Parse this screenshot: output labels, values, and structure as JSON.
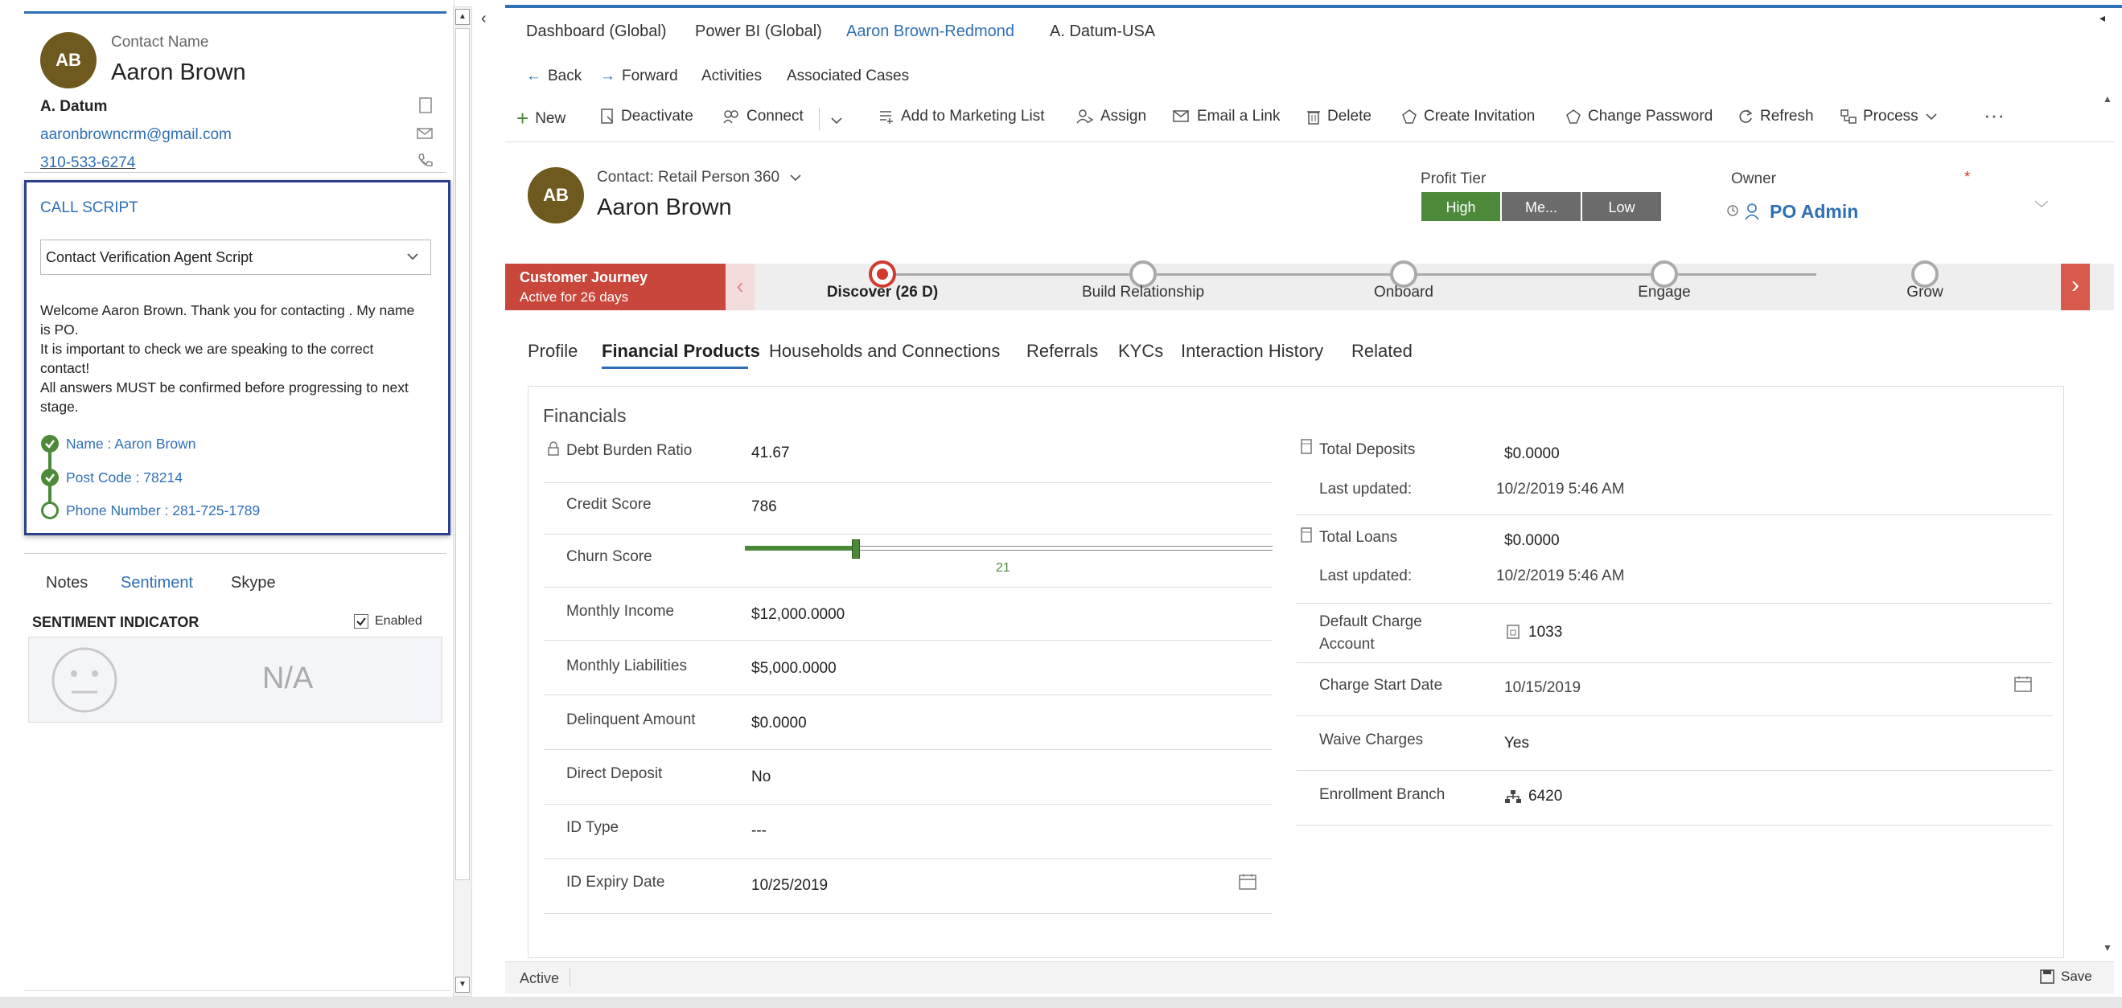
{
  "contact_card": {
    "initials": "AB",
    "label": "Contact Name",
    "name": "Aaron Brown",
    "company": "A. Datum",
    "email": "aaronbrowncrm@gmail.com",
    "phone": "310-533-6274"
  },
  "call_script": {
    "title": "CALL SCRIPT",
    "selected_script": "Contact Verification Agent Script",
    "lines": [
      "Welcome Aaron Brown. Thank you for contacting . My name",
      "is PO.",
      "It is important to check we are speaking to the correct",
      "contact!",
      "All answers MUST be confirmed before progressing to next",
      "stage."
    ],
    "checks": [
      {
        "label": "Name : Aaron Brown",
        "done": true
      },
      {
        "label": "Post Code : 78214",
        "done": true
      },
      {
        "label": "Phone Number : 281-725-1789",
        "done": false
      }
    ]
  },
  "bottom_tabs": {
    "notes": "Notes",
    "sentiment": "Sentiment",
    "skype": "Skype"
  },
  "sentiment": {
    "title": "SENTIMENT INDICATOR",
    "enabled_label": "Enabled",
    "value": "N/A"
  },
  "top_tabs": [
    "Dashboard (Global)",
    "Power BI (Global)",
    "Aaron Brown-Redmond",
    "A. Datum-USA"
  ],
  "nav": {
    "back": "Back",
    "forward": "Forward",
    "activities": "Activities",
    "associated_cases": "Associated Cases"
  },
  "commands": {
    "new": "New",
    "deactivate": "Deactivate",
    "connect": "Connect",
    "add_marketing": "Add to Marketing List",
    "assign": "Assign",
    "email_link": "Email a Link",
    "delete": "Delete",
    "create_invitation": "Create Invitation",
    "change_password": "Change Password",
    "refresh": "Refresh",
    "process": "Process",
    "more": "···"
  },
  "record": {
    "initials": "AB",
    "form": "Contact: Retail Person 360",
    "name": "Aaron Brown",
    "profit_tier_label": "Profit Tier",
    "tiers": [
      "High",
      "Me...",
      "Low"
    ],
    "owner_label": "Owner",
    "owner": "PO Admin",
    "required_mark": "*"
  },
  "journey": {
    "title": "Customer Journey",
    "subtitle": "Active for 26 days",
    "stages": [
      "Discover  (26 D)",
      "Build Relationship",
      "Onboard",
      "Engage",
      "Grow"
    ]
  },
  "form_tabs": [
    "Profile",
    "Financial Products",
    "Households and Connections",
    "Referrals",
    "KYCs",
    "Interaction History",
    "Related"
  ],
  "financials": {
    "title": "Financials",
    "left": [
      {
        "label": "Debt Burden Ratio",
        "value": "41.67"
      },
      {
        "label": "Credit Score",
        "value": "786"
      },
      {
        "label": "Churn Score",
        "value": "21"
      },
      {
        "label": "Monthly Income",
        "value": "$12,000.0000"
      },
      {
        "label": "Monthly Liabilities",
        "value": "$5,000.0000"
      },
      {
        "label": "Delinquent Amount",
        "value": "$0.0000"
      },
      {
        "label": "Direct Deposit",
        "value": "No"
      },
      {
        "label": "ID Type",
        "value": "---"
      },
      {
        "label": "ID Expiry Date",
        "value": "10/25/2019"
      }
    ],
    "churn_fraction": 0.21,
    "right": {
      "total_deposits_label": "Total Deposits",
      "total_deposits": "$0.0000",
      "last_updated_label": "Last updated:",
      "deposits_updated": "10/2/2019 5:46 AM",
      "total_loans_label": "Total Loans",
      "total_loans": "$0.0000",
      "loans_updated": "10/2/2019 5:46 AM",
      "default_charge_label_1": "Default Charge",
      "default_charge_label_2": "Account",
      "default_charge": "1033",
      "charge_start_label": "Charge Start Date",
      "charge_start": "10/15/2019",
      "waive_label": "Waive Charges",
      "waive": "Yes",
      "branch_label": "Enrollment Branch",
      "branch": "6420"
    }
  },
  "status": {
    "state": "Active",
    "save": "Save"
  }
}
